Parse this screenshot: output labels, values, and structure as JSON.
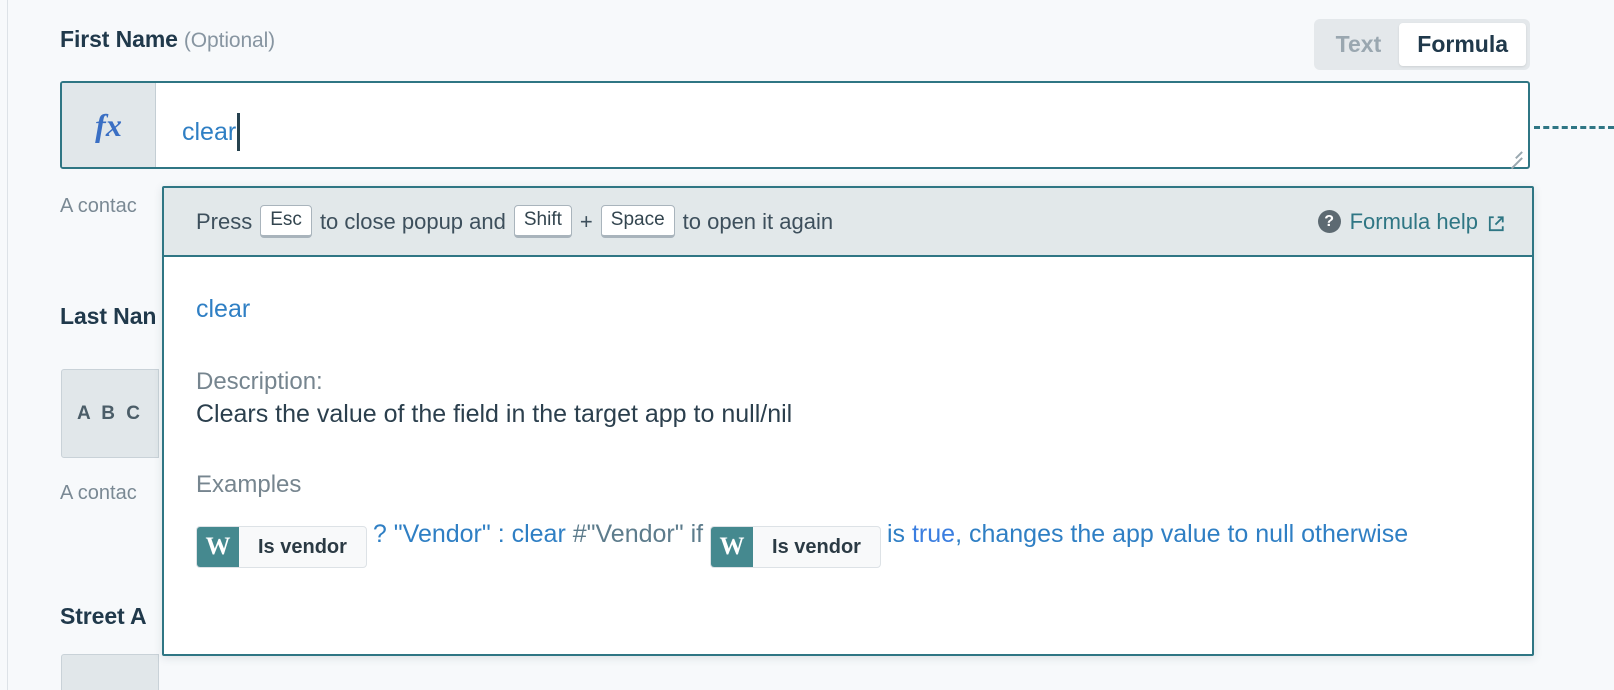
{
  "field": {
    "label": "First Name",
    "optional_tag": "(Optional)",
    "fx_icon": "fx",
    "formula_value": "clear",
    "help_text": "A contac",
    "mode_toggle": {
      "text_label": "Text",
      "formula_label": "Formula",
      "selected": "Formula"
    }
  },
  "background_fields": [
    {
      "label": "Last Nan",
      "type_badge": "A B C",
      "help_text": "A contac"
    },
    {
      "label": "Street A",
      "type_badge": ""
    }
  ],
  "popup": {
    "hint": {
      "press": "Press",
      "key_esc": "Esc",
      "mid": "to close popup and",
      "key_shift": "Shift",
      "plus": "+",
      "key_space": "Space",
      "tail": "to open it again"
    },
    "help_link": {
      "label": "Formula help",
      "question_icon": "?",
      "external_icon": "external-link"
    },
    "function_name": "clear",
    "description_head": "Description:",
    "description_text": "Clears the value of the field in the target app to null/nil",
    "examples_head": "Examples",
    "example": {
      "token_badge": "W",
      "token_label": "Is vendor",
      "segment_1": "? \"Vendor\" : clear",
      "segment_2": "#\"Vendor\" if",
      "token2_badge": "W",
      "token2_label": "Is vendor",
      "segment_3": "is",
      "segment_4": "true",
      "segment_5": ", changes the app value to null otherwise"
    }
  },
  "colors": {
    "accent_teal": "#2f7684",
    "link_blue": "#2f7fc4",
    "token_teal": "#45898f",
    "header_bg": "#e2e8ea",
    "page_bg": "#f7f9fb"
  }
}
